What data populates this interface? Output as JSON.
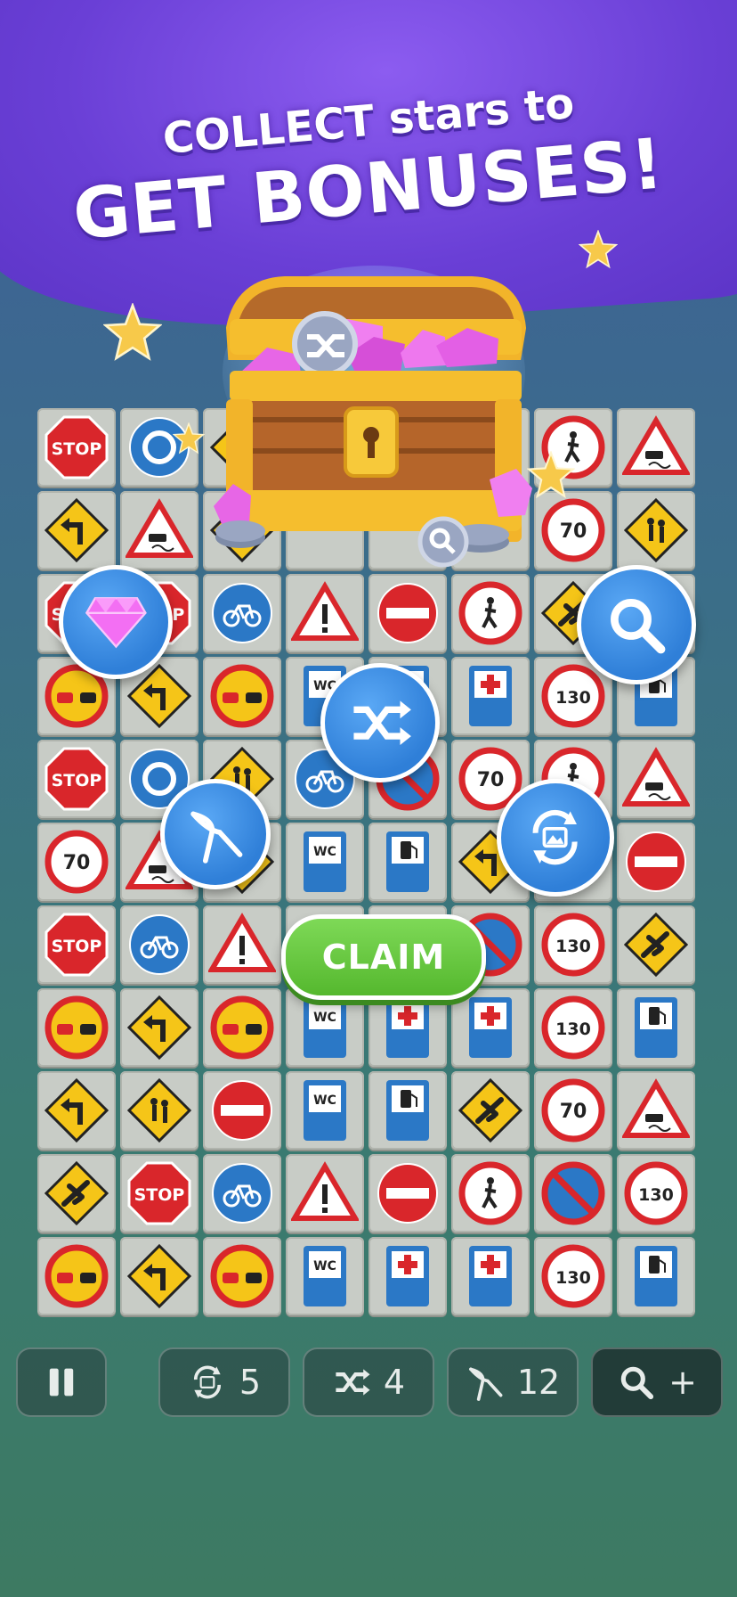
{
  "banner": {
    "line1": "COLLECT stars to",
    "line2": "GET BONUSES!"
  },
  "claim_label": "CLAIM",
  "toolbar": {
    "pause_icon": "pause-icon",
    "swap_count": "5",
    "shuffle_count": "4",
    "pliers_count": "12",
    "hint_plus": "+"
  },
  "colors": {
    "banner": "#6a3fd6",
    "claim_green": "#5fc23a",
    "bubble_blue": "#2f7fd8"
  },
  "sign_text": {
    "stop": "STOP",
    "wc": "WC",
    "n70": "70",
    "n130": "130"
  },
  "board": {
    "rows": [
      [
        "stop",
        "roundabout",
        "elderly",
        "hidden",
        "hidden",
        "hidden",
        "pedestrian-noentry",
        "slippery"
      ],
      [
        "turn-left",
        "slippery",
        "turn-left",
        "hidden",
        "hidden",
        "hidden",
        "speed-70",
        "elderly"
      ],
      [
        "stop",
        "stop",
        "bicycle",
        "warning",
        "no-entry",
        "pedestrian-noentry",
        "airport",
        "hidden"
      ],
      [
        "no-overtaking",
        "turn-left",
        "no-overtaking",
        "wc",
        "wc",
        "hospital",
        "speed-130",
        "fuel"
      ],
      [
        "stop",
        "roundabout",
        "elderly",
        "bicycle",
        "no-parking",
        "speed-70",
        "pedestrian-noentry",
        "slippery"
      ],
      [
        "speed-70",
        "slippery",
        "elderly",
        "wc",
        "fuel",
        "turn-left",
        "turn-left",
        "no-entry"
      ],
      [
        "stop",
        "bicycle",
        "warning",
        "hidden",
        "hidden",
        "no-parking",
        "speed-130",
        "airport"
      ],
      [
        "no-overtaking",
        "turn-left",
        "no-overtaking",
        "wc",
        "hospital",
        "hospital",
        "speed-130",
        "fuel"
      ],
      [
        "turn-left",
        "elderly",
        "no-entry",
        "wc",
        "fuel",
        "airport",
        "speed-70",
        "slippery"
      ],
      [
        "airport",
        "stop",
        "bicycle",
        "warning",
        "no-entry",
        "pedestrian-noentry",
        "no-parking",
        "speed-130"
      ],
      [
        "no-overtaking",
        "turn-left",
        "no-overtaking",
        "wc",
        "hospital",
        "hospital",
        "speed-130",
        "fuel"
      ]
    ]
  }
}
